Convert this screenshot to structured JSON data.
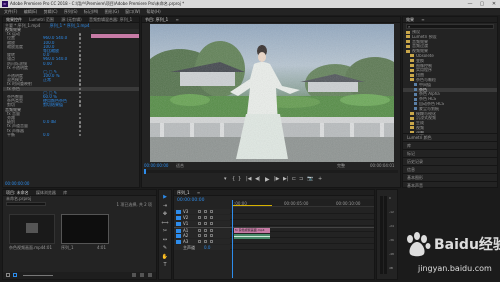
{
  "window": {
    "title": "Adobe Premiere Pro CC 2018 - C:\\用户\\Premiere\\项目\\Adobe Premiere Pro\\未命名.prproj *",
    "logo": "Pr",
    "min": "—",
    "max": "▢",
    "close": "✕"
  },
  "menu": [
    "文件(F)",
    "编辑(E)",
    "剪辑(C)",
    "序列(S)",
    "标记(M)",
    "图形(G)",
    "窗口(W)",
    "帮助(H)"
  ],
  "effect_controls": {
    "tabs": [
      "效果控件",
      "Lumetri 范围",
      "源:(无剪辑)",
      "音频剪辑混合器: 序列_1"
    ],
    "clip": "主要 * 序列_1.mp4",
    "seq": "序列_1 * 序列_1.mp4",
    "rows": [
      {
        "label": "视频效果",
        "value": "",
        "kind": "hdr"
      },
      {
        "label": "fx 运动",
        "value": ""
      },
      {
        "label": "位置",
        "value": "960.0  540.0"
      },
      {
        "label": "缩放",
        "value": "100.0"
      },
      {
        "label": "缩放宽度",
        "value": "100.0"
      },
      {
        "label": "",
        "value": "等比缩放"
      },
      {
        "label": "旋转",
        "value": "0.0"
      },
      {
        "label": "锚点",
        "value": "960.0  540.0"
      },
      {
        "label": "防闪烁滤镜",
        "value": "0.00"
      },
      {
        "label": "fx 不透明度",
        "value": ""
      },
      {
        "label": "",
        "value": "◯ ▢ ✎"
      },
      {
        "label": "不透明度",
        "value": "100.0 %"
      },
      {
        "label": "混合模式",
        "value": "正常"
      },
      {
        "label": "fx 时间重映射",
        "value": ""
      },
      {
        "label": "fx 杂色",
        "value": ""
      },
      {
        "label": "",
        "value": "◯ ▢ ✎"
      },
      {
        "label": "杂色数量",
        "value": "60.0 %"
      },
      {
        "label": "杂色类型",
        "value": "使用颜色杂色"
      },
      {
        "label": "剪切",
        "value": "剪切结果值"
      },
      {
        "label": "音频效果",
        "value": "",
        "kind": "hdr"
      },
      {
        "label": "fx 音量",
        "value": ""
      },
      {
        "label": "旁路",
        "value": ""
      },
      {
        "label": "级别",
        "value": "0.0 dB"
      },
      {
        "label": "fx 声道音量",
        "value": ""
      },
      {
        "label": "fx 声像器",
        "value": ""
      },
      {
        "label": "平衡",
        "value": "0.0"
      }
    ],
    "timecode": "00:00:00:00"
  },
  "program": {
    "tabs": [
      "节目: 序列_1",
      "≡"
    ],
    "timecode_left": "00:00:00:00",
    "fit": "适合",
    "fraction": "完整",
    "timecode_right": "00:00:04:01",
    "controls": [
      "▾",
      "{",
      "}",
      "|◀",
      "◀|",
      "▶",
      "|▶",
      "▶|",
      "⊏",
      "⊐",
      "📷",
      "+"
    ]
  },
  "effects_panel": {
    "tabs": [
      "效果",
      "≡"
    ],
    "search": "",
    "items": [
      {
        "label": "预设",
        "level": 0
      },
      {
        "label": "Lumetri 预设",
        "level": 0
      },
      {
        "label": "音频效果",
        "level": 0
      },
      {
        "label": "音频过渡",
        "level": 0
      },
      {
        "label": "视频效果",
        "level": 0
      },
      {
        "label": "Obsolete",
        "level": 1
      },
      {
        "label": "变换",
        "level": 1
      },
      {
        "label": "图像控制",
        "level": 1
      },
      {
        "label": "实用程序",
        "level": 1
      },
      {
        "label": "扭曲",
        "level": 1
      },
      {
        "label": "杂色与颗粒",
        "level": 1
      },
      {
        "label": "中间值",
        "level": 2
      },
      {
        "label": "杂色",
        "level": 2
      },
      {
        "label": "杂色 Alpha",
        "level": 2
      },
      {
        "label": "杂色 HLS",
        "level": 2
      },
      {
        "label": "自动杂色 HLS",
        "level": 2
      },
      {
        "label": "蒙尘与划痕",
        "level": 2
      },
      {
        "label": "模糊与锐化",
        "level": 1
      },
      {
        "label": "沉浸式视频",
        "level": 1
      },
      {
        "label": "生成",
        "level": 1
      },
      {
        "label": "视频",
        "level": 1
      },
      {
        "label": "调整",
        "level": 1
      }
    ],
    "extra": [
      "Lumetri 颜色",
      "库",
      "标记",
      "历史记录",
      "信息",
      "基本图形",
      "基本声音"
    ]
  },
  "project": {
    "tabs": [
      "项目: 未命名",
      "媒体浏览器",
      "库"
    ],
    "file": "未命名.prproj",
    "count": "1 项已选择, 共 2 项",
    "items": [
      {
        "name": "杂色视频画面.mp4",
        "meta": "4:01"
      },
      {
        "name": "序列_1",
        "meta": "4:01"
      }
    ]
  },
  "tools": [
    "▶",
    "⇥",
    "✥",
    "⟺",
    "✂",
    "↔",
    "✎",
    "✋",
    "T"
  ],
  "timeline": {
    "tabs": [
      "序列_1",
      "≡"
    ],
    "timecode": "00:00:00:00",
    "ruler": [
      ":00:00",
      "00:00:05:00",
      "00:00:10:00"
    ],
    "tracks": [
      {
        "name": "V3"
      },
      {
        "name": "V2"
      },
      {
        "name": "V1"
      },
      {
        "name": "A1"
      },
      {
        "name": "A2"
      },
      {
        "name": "A3"
      },
      {
        "name": "主声道",
        "value": "0.0"
      }
    ],
    "clip_v": "fx 杂色视频画面.mp4",
    "clip_a": ""
  },
  "meter": [
    "0",
    "-12",
    "-24",
    "-36",
    "-48",
    "dB"
  ],
  "watermark": {
    "brand": "Baidu经验",
    "url": "jingyan.baidu.com"
  },
  "colors": {
    "accent": "#2d8ceb",
    "clip_video": "#c77ba6",
    "clip_audio": "#4a8a6a",
    "playhead": "#2d8ceb"
  }
}
